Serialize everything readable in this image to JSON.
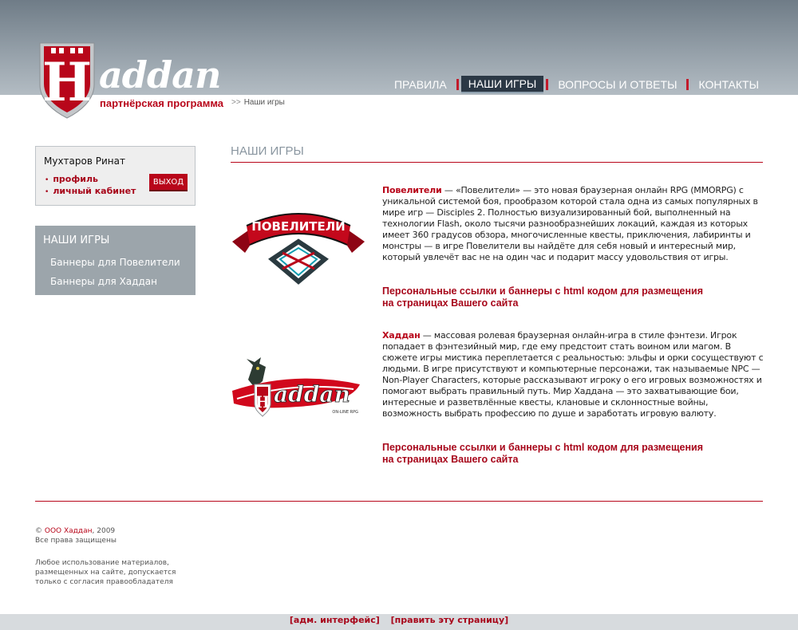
{
  "brand": {
    "logo_text": "Haddan",
    "tagline": "партнёрская программа"
  },
  "breadcrumb": {
    "arrows": ">>",
    "current": "Наши игры"
  },
  "topnav": [
    {
      "label": "ПРАВИЛА",
      "active": false
    },
    {
      "label": "НАШИ ИГРЫ",
      "active": true
    },
    {
      "label": "ВОПРОСЫ И ОТВЕТЫ",
      "active": false
    },
    {
      "label": "КОНТАКТЫ",
      "active": false
    }
  ],
  "user": {
    "name": "Мухтаров Ринат",
    "links": [
      "профиль",
      "личный кабинет"
    ],
    "logout_label": "ВЫХОД"
  },
  "games_nav": {
    "title": "НАШИ ИГРЫ",
    "links": [
      "Баннеры для Повелители",
      "Баннеры для Хаддан"
    ]
  },
  "page_title": "НАШИ ИГРЫ",
  "games": [
    {
      "name": "Повелители",
      "logo_text": "ПОВЕЛИТЕЛИ",
      "description": " — «Повелители» — это новая браузерная онлайн RPG (MMORPG) с уникальной системой боя, прообразом которой стала одна из самых популярных в мире игр — Disciples 2. Полностью визуализированный бой, выполненный на технологии Flash, около тысячи разнообразнейших локаций, каждая из которых имеет 360 градусов обзора, многочисленные квесты, приключения, лабиринты и монстры — в игре Повелители вы найдёте для себя новый и интересный мир, который увлечёт вас не на один час и подарит массу удовольствия от игры.",
      "link_line1": "Персональные ссылки и баннеры с html кодом для размещения",
      "link_line2": "на страницах Вашего сайта"
    },
    {
      "name": "Хаддан",
      "logo_text": "Haddan",
      "logo_sub": "ON-LINE RPG",
      "description": " — массовая ролевая браузерная онлайн-игра в стиле фэнтези. Игрок попадает в фэнтезийный мир, где ему предстоит стать воином или магом. В сюжете игры мистика переплетается с реальностью: эльфы и орки сосуществуют с людьми. В игре присутствуют и компьютерные персонажи, так называемые NPC — Non-Player Characters, которые рассказывают игроку о его игровых возможностях и помогают выбрать правильный путь. Мир Хаддана — это захватывающие бои, интересные и разветвлённые квесты, клановые и склонностные войны, возможность выбрать профессию по душе и заработать игровую валюту.",
      "link_line1": "Персональные ссылки и баннеры с html кодом для размещения",
      "link_line2": "на страницах Вашего сайта"
    }
  ],
  "footer": {
    "copyright_symbol": "©",
    "company": "ООО Хаддан",
    "year": ", 2009",
    "rights": "Все права защищены",
    "notice": "Любое использование материалов, размещенных на сайте, допускается только с согласия правообладателя"
  },
  "admin": {
    "link1": "[адм. интерфейс]",
    "link2": "[править эту страницу]"
  },
  "colors": {
    "accent": "#b8061a",
    "header_bg": "#95a0a9",
    "nav_active_bg": "#2b3845",
    "sidebar_bg": "#9ca5ab"
  }
}
